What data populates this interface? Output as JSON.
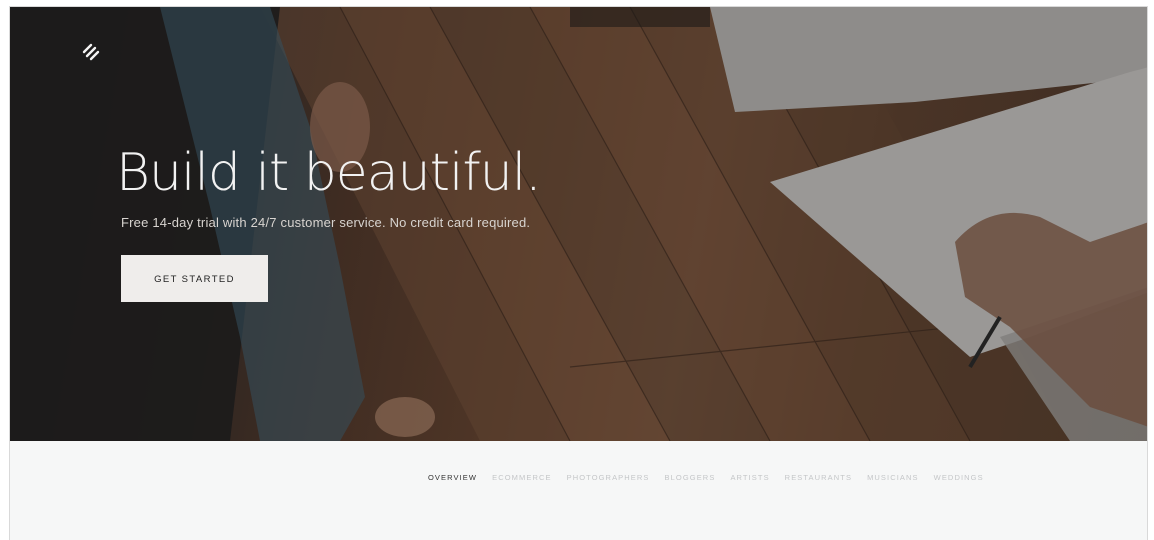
{
  "hero": {
    "headline": "Build it beautiful.",
    "subline": "Free 14-day trial with 24/7 customer service. No credit card required.",
    "cta_label": "GET STARTED",
    "logo_icon": "squarespace-logo-icon"
  },
  "nav": {
    "tabs": [
      {
        "label": "OVERVIEW",
        "active": true
      },
      {
        "label": "ECOMMERCE",
        "active": false
      },
      {
        "label": "PHOTOGRAPHERS",
        "active": false
      },
      {
        "label": "BLOGGERS",
        "active": false
      },
      {
        "label": "ARTISTS",
        "active": false
      },
      {
        "label": "RESTAURANTS",
        "active": false
      },
      {
        "label": "MUSICIANS",
        "active": false
      },
      {
        "label": "WEDDINGS",
        "active": false
      }
    ]
  },
  "colors": {
    "cta_background": "#efedeb",
    "active_tab": "#333333",
    "inactive_tab": "#c4c6c8",
    "lower_background": "#f6f7f7"
  }
}
